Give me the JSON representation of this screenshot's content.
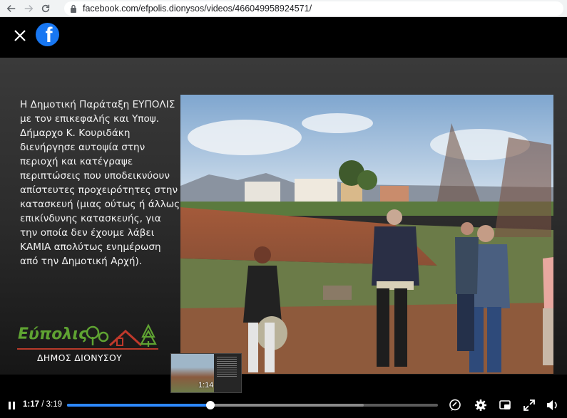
{
  "browser": {
    "url": "facebook.com/efpolis.dionysos/videos/466049958924571/",
    "icons": [
      "back-arrow-icon",
      "forward-arrow-icon",
      "reload-icon",
      "lock-icon"
    ]
  },
  "viewer": {
    "brand_color": "#1877f2",
    "caption": "Η Δημοτική Παράταξη ΕΥΠΟΛΙΣ με τον επικεφαλής και Υποψ. Δήμαρχο Κ. Κουριδάκη διενήργησε αυτοψία στην περιοχή και κατέγραψε περιπτώσεις που υποδεικνύουν απίστευτες προχειρότητες στην κατασκευή (μιας ούτως ή άλλως επικίνδυνης κατασκευής, για την οποία δεν έχουμε λάβει ΚΑΜΙΑ απολύτως ενημέρωση από την Δημοτική Αρχή).",
    "logo_word": "Εύπολις",
    "logo_subtitle": "ΔΗΜΟΣ ΔΙΟΝΥΣΟΥ",
    "logo_colors": {
      "green": "#5fa332",
      "red": "#b83a2a"
    }
  },
  "player": {
    "current_time": "1:17",
    "separator": " / ",
    "duration": "3:19",
    "preview_time": "1:14",
    "progress_fraction": 0.386,
    "buffer_fraction": 0.8,
    "accent": "#2d88ff"
  }
}
